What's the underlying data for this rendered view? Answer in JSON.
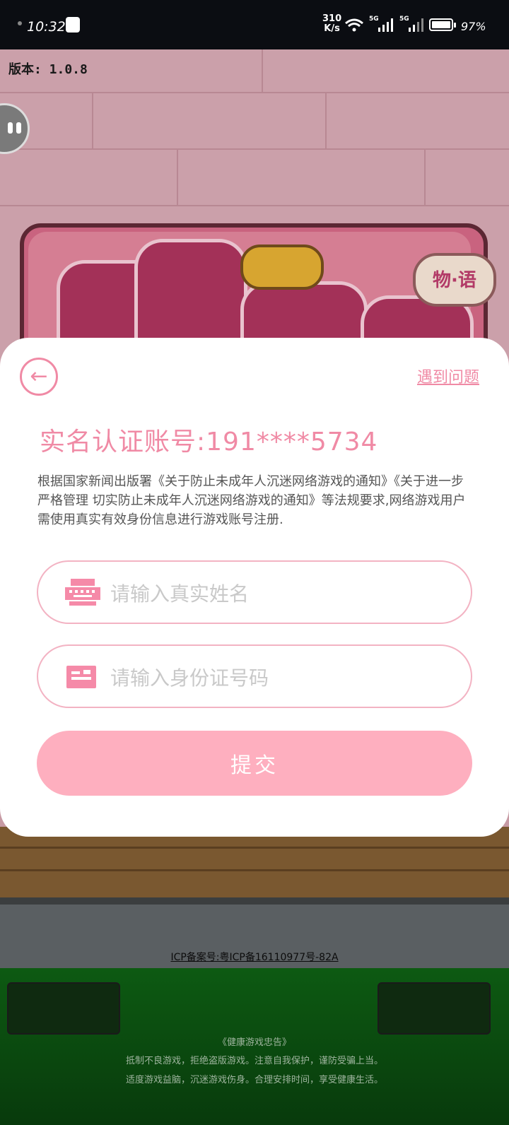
{
  "status_bar": {
    "time": "10:32",
    "net_speed_value": "310",
    "net_speed_unit": "K/s",
    "signal1_label": "5G",
    "signal2_label": "5G",
    "battery": "97%",
    "battery_level": 0.97
  },
  "game": {
    "version": "版本: 1.0.8",
    "logo_tag": "物·语",
    "icp": "ICP备案号:粤ICP备16110977号-82A",
    "health_notice": {
      "title": "《健康游戏忠告》",
      "line1": "抵制不良游戏，拒绝盗版游戏。注意自我保护，谨防受骗上当。",
      "line2": "适度游戏益脑，沉迷游戏伤身。合理安排时间，享受健康生活。"
    }
  },
  "modal": {
    "back_icon": "←",
    "help_link": "遇到问题",
    "title": "实名认证账号:191****5734",
    "description": "根据国家新闻出版署《关于防止未成年人沉迷网络游戏的通知》《关于进一步严格管理 切实防止未成年人沉迷网络游戏的通知》等法规要求,网络游戏用户需使用真实有效身份信息进行游戏账号注册.",
    "name_field": {
      "placeholder": "请输入真实姓名",
      "value": "",
      "icon": "id-card-icon"
    },
    "id_field": {
      "placeholder": "请输入身份证号码",
      "value": "",
      "icon": "document-icon"
    },
    "submit_label": "提交",
    "accent_color": "#f08aa5",
    "button_color": "#feafbf"
  }
}
